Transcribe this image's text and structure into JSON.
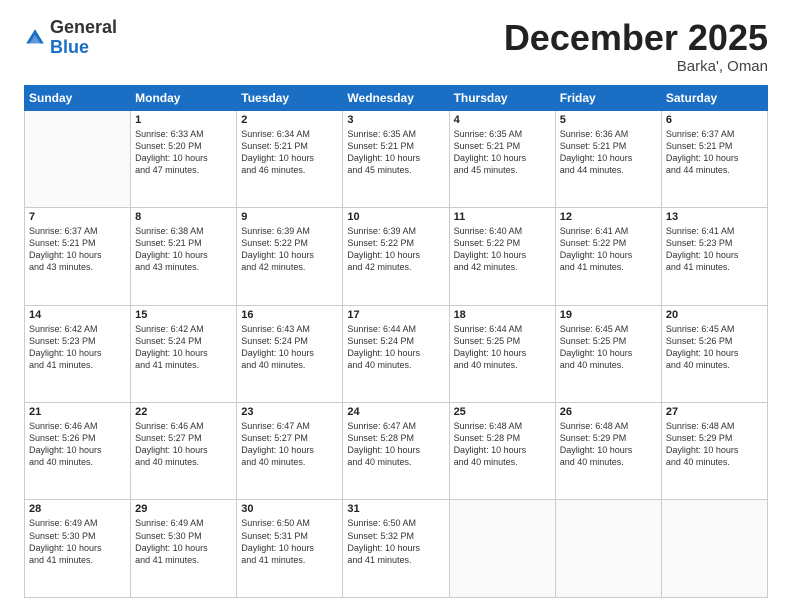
{
  "header": {
    "logo_line1": "General",
    "logo_line2": "Blue",
    "month_title": "December 2025",
    "location": "Barka', Oman"
  },
  "days_of_week": [
    "Sunday",
    "Monday",
    "Tuesday",
    "Wednesday",
    "Thursday",
    "Friday",
    "Saturday"
  ],
  "weeks": [
    [
      {
        "day": "",
        "info": ""
      },
      {
        "day": "1",
        "info": "Sunrise: 6:33 AM\nSunset: 5:20 PM\nDaylight: 10 hours\nand 47 minutes."
      },
      {
        "day": "2",
        "info": "Sunrise: 6:34 AM\nSunset: 5:21 PM\nDaylight: 10 hours\nand 46 minutes."
      },
      {
        "day": "3",
        "info": "Sunrise: 6:35 AM\nSunset: 5:21 PM\nDaylight: 10 hours\nand 45 minutes."
      },
      {
        "day": "4",
        "info": "Sunrise: 6:35 AM\nSunset: 5:21 PM\nDaylight: 10 hours\nand 45 minutes."
      },
      {
        "day": "5",
        "info": "Sunrise: 6:36 AM\nSunset: 5:21 PM\nDaylight: 10 hours\nand 44 minutes."
      },
      {
        "day": "6",
        "info": "Sunrise: 6:37 AM\nSunset: 5:21 PM\nDaylight: 10 hours\nand 44 minutes."
      }
    ],
    [
      {
        "day": "7",
        "info": "Sunrise: 6:37 AM\nSunset: 5:21 PM\nDaylight: 10 hours\nand 43 minutes."
      },
      {
        "day": "8",
        "info": "Sunrise: 6:38 AM\nSunset: 5:21 PM\nDaylight: 10 hours\nand 43 minutes."
      },
      {
        "day": "9",
        "info": "Sunrise: 6:39 AM\nSunset: 5:22 PM\nDaylight: 10 hours\nand 42 minutes."
      },
      {
        "day": "10",
        "info": "Sunrise: 6:39 AM\nSunset: 5:22 PM\nDaylight: 10 hours\nand 42 minutes."
      },
      {
        "day": "11",
        "info": "Sunrise: 6:40 AM\nSunset: 5:22 PM\nDaylight: 10 hours\nand 42 minutes."
      },
      {
        "day": "12",
        "info": "Sunrise: 6:41 AM\nSunset: 5:22 PM\nDaylight: 10 hours\nand 41 minutes."
      },
      {
        "day": "13",
        "info": "Sunrise: 6:41 AM\nSunset: 5:23 PM\nDaylight: 10 hours\nand 41 minutes."
      }
    ],
    [
      {
        "day": "14",
        "info": "Sunrise: 6:42 AM\nSunset: 5:23 PM\nDaylight: 10 hours\nand 41 minutes."
      },
      {
        "day": "15",
        "info": "Sunrise: 6:42 AM\nSunset: 5:24 PM\nDaylight: 10 hours\nand 41 minutes."
      },
      {
        "day": "16",
        "info": "Sunrise: 6:43 AM\nSunset: 5:24 PM\nDaylight: 10 hours\nand 40 minutes."
      },
      {
        "day": "17",
        "info": "Sunrise: 6:44 AM\nSunset: 5:24 PM\nDaylight: 10 hours\nand 40 minutes."
      },
      {
        "day": "18",
        "info": "Sunrise: 6:44 AM\nSunset: 5:25 PM\nDaylight: 10 hours\nand 40 minutes."
      },
      {
        "day": "19",
        "info": "Sunrise: 6:45 AM\nSunset: 5:25 PM\nDaylight: 10 hours\nand 40 minutes."
      },
      {
        "day": "20",
        "info": "Sunrise: 6:45 AM\nSunset: 5:26 PM\nDaylight: 10 hours\nand 40 minutes."
      }
    ],
    [
      {
        "day": "21",
        "info": "Sunrise: 6:46 AM\nSunset: 5:26 PM\nDaylight: 10 hours\nand 40 minutes."
      },
      {
        "day": "22",
        "info": "Sunrise: 6:46 AM\nSunset: 5:27 PM\nDaylight: 10 hours\nand 40 minutes."
      },
      {
        "day": "23",
        "info": "Sunrise: 6:47 AM\nSunset: 5:27 PM\nDaylight: 10 hours\nand 40 minutes."
      },
      {
        "day": "24",
        "info": "Sunrise: 6:47 AM\nSunset: 5:28 PM\nDaylight: 10 hours\nand 40 minutes."
      },
      {
        "day": "25",
        "info": "Sunrise: 6:48 AM\nSunset: 5:28 PM\nDaylight: 10 hours\nand 40 minutes."
      },
      {
        "day": "26",
        "info": "Sunrise: 6:48 AM\nSunset: 5:29 PM\nDaylight: 10 hours\nand 40 minutes."
      },
      {
        "day": "27",
        "info": "Sunrise: 6:48 AM\nSunset: 5:29 PM\nDaylight: 10 hours\nand 40 minutes."
      }
    ],
    [
      {
        "day": "28",
        "info": "Sunrise: 6:49 AM\nSunset: 5:30 PM\nDaylight: 10 hours\nand 41 minutes."
      },
      {
        "day": "29",
        "info": "Sunrise: 6:49 AM\nSunset: 5:30 PM\nDaylight: 10 hours\nand 41 minutes."
      },
      {
        "day": "30",
        "info": "Sunrise: 6:50 AM\nSunset: 5:31 PM\nDaylight: 10 hours\nand 41 minutes."
      },
      {
        "day": "31",
        "info": "Sunrise: 6:50 AM\nSunset: 5:32 PM\nDaylight: 10 hours\nand 41 minutes."
      },
      {
        "day": "",
        "info": ""
      },
      {
        "day": "",
        "info": ""
      },
      {
        "day": "",
        "info": ""
      }
    ]
  ]
}
